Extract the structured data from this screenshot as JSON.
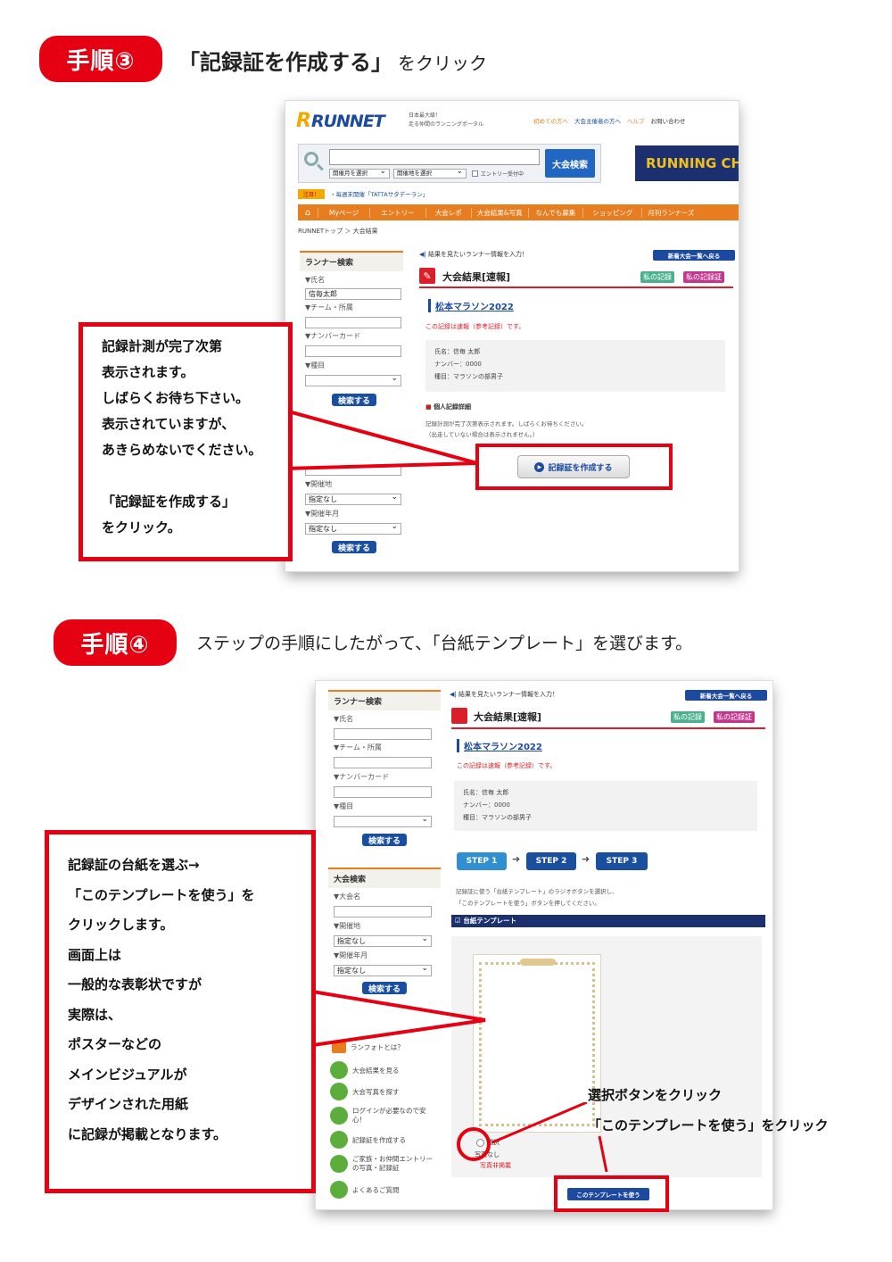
{
  "step3": {
    "badge": "手順③",
    "heading": "「記録証を作成する」",
    "heading_suffix": "をクリック"
  },
  "shot1": {
    "logo": "RUNNET",
    "logo_sub1": "日本最大級！",
    "logo_sub2": "走る仲間のランニングポータル",
    "top_links": [
      "初めての方へ",
      "大会主催者の方へ",
      "ヘルプ",
      "お問い合わせ"
    ],
    "search_button": "大会検索",
    "filter1": "開催月を選択",
    "filter2": "開催地を選択",
    "entry_check": "エントリー受付中",
    "banner_right": "RUNNING CHA",
    "notice_tag": "注目！",
    "notice_text": "・毎週末開催「TATTAサタデーラン」",
    "nav": [
      "Myページ",
      "エントリー",
      "大会レポ",
      "大会結果&写真",
      "なんでも募集",
      "ショッピング",
      "月刊ランナーズ"
    ],
    "breadcrumb": "RUNNETトップ ＞ 大会結果",
    "side_title": "ランナー検索",
    "label_name": "▼氏名",
    "name_value": "信毎太郎",
    "label_team": "▼チーム・所属",
    "label_number": "▼ナンバーカード",
    "label_event": "▼種目",
    "search_btn": "検索する",
    "label_place": "▼開催地",
    "place_value": "指定なし",
    "label_month": "▼開催年月",
    "month_value": "指定なし",
    "prompt": "結果を見たいランナー情報を入力！",
    "back_btn": "新着大会一覧へ戻る",
    "result_title": "大会結果[速報]",
    "tag_my_record": "私の記録",
    "tag_my_cert": "私の記録証",
    "race_name": "松本マラソン2022",
    "prelim_note": "この記録は速報（参考記録）です。",
    "runner_name": "氏名：信毎 太郎",
    "runner_number": "ナンバー：0000",
    "runner_event": "種目：マラソンの部男子",
    "detail_head": "個人記録詳細",
    "detail_text1": "記録計測が完了次第表示されます。しばらくお待ちください。",
    "detail_text2": "（出走していない場合は表示されません。）",
    "create_btn": "記録証を作成する"
  },
  "note1": [
    "記録計測が完了次第",
    "表示されます。",
    "しばらくお待ち下さい。",
    "表示されていますが、",
    "あきらめないでください。",
    "",
    "「記録証を作成する」",
    "をクリック。"
  ],
  "step4": {
    "badge": "手順④",
    "heading": "ステップの手順にしたがって、「台紙テンプレート」を選びます。"
  },
  "shot2": {
    "side_title": "ランナー検索",
    "label_name": "▼氏名",
    "label_team": "▼チーム・所属",
    "label_number": "▼ナンバーカード",
    "label_event": "▼種目",
    "search_btn": "検索する",
    "side_title2": "大会検索",
    "label_race": "▼大会名",
    "label_place": "▼開催地",
    "place_value": "指定なし",
    "label_month": "▼開催年月",
    "month_value": "指定なし",
    "runphoto": "ランフォトとは？",
    "steps": [
      "大会結果を見る",
      "大会写真を探す",
      "ログインが必要なので安心！",
      "記録証を作成する",
      "ご家族・お仲間エントリーの写真・記録証",
      "よくあるご質問"
    ],
    "prompt": "結果を見たいランナー情報を入力！",
    "back_btn": "新着大会一覧へ戻る",
    "result_title": "大会結果[速報]",
    "tag_my_record": "私の記録",
    "tag_my_cert": "私の記録証",
    "race_name": "松本マラソン2022",
    "prelim_note": "この記録は速報（参考記録）です。",
    "runner_name": "氏名：信毎 太郎",
    "runner_number": "ナンバー：0000",
    "runner_event": "種目：マラソンの部男子",
    "step1": "STEP 1",
    "step2": "STEP 2",
    "step3": "STEP 3",
    "instr1": "記録証に使う「台紙テンプレート」のラジオボタンを選択し、",
    "instr2": "「このテンプレートを使う」ボタンを押してください。",
    "template_head": "台紙テンプレート",
    "radio_label": "選択",
    "photo_none": "写真なし",
    "photo_note": "写真非掲載",
    "use_btn": "このテンプレートを使う"
  },
  "note2": [
    "記録証の台紙を選ぶ→",
    "「このテンプレートを使う」を",
    "クリックします。",
    "画面上は",
    "一般的な表彰状ですが",
    "実際は、",
    "ポスターなどの",
    "メインビジュアルが",
    "デザインされた用紙",
    "に記録が掲載となります。"
  ],
  "callout": {
    "line1": "選択ボタンをクリック",
    "line2": "「このテンプレートを使う」をクリック"
  },
  "colors": {
    "red": "#e50012",
    "blue": "#1a4fa0",
    "orange": "#e87d20",
    "navy": "#1c2f6e"
  }
}
